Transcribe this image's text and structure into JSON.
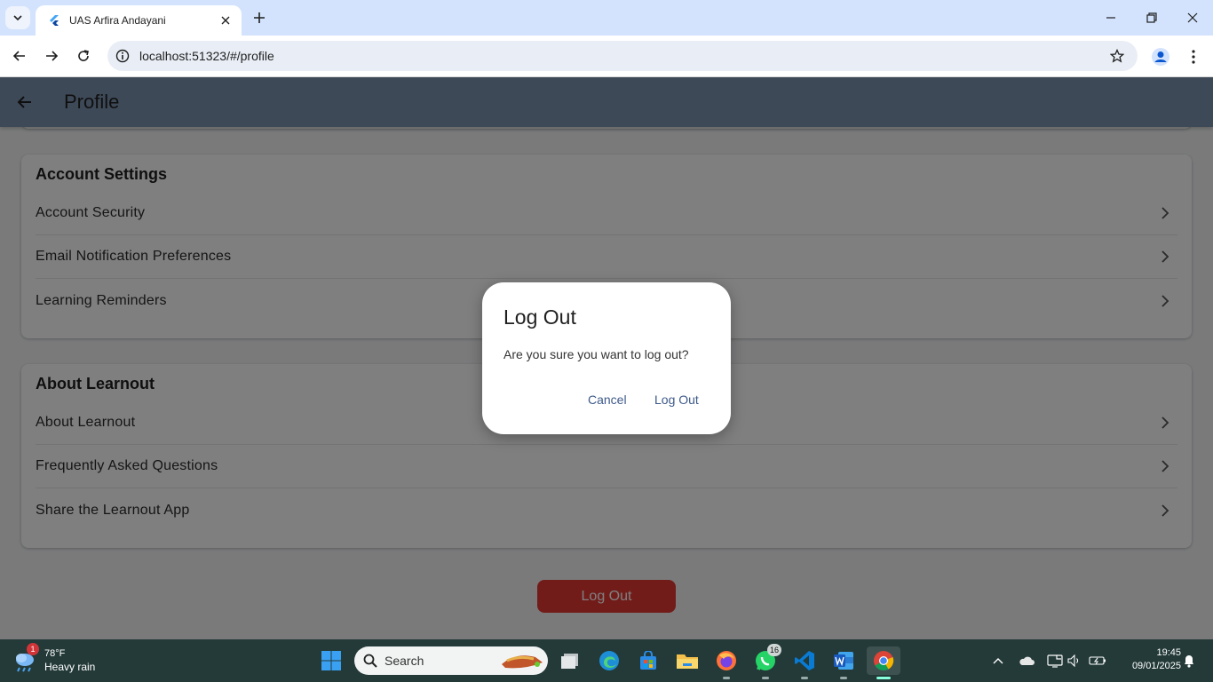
{
  "browser": {
    "tab_title": "UAS Arfira Andayani",
    "url": "localhost:51323/#/profile"
  },
  "app": {
    "title": "Profile",
    "sections": [
      {
        "title": "Account Settings",
        "items": [
          "Account Security",
          "Email Notification Preferences",
          "Learning Reminders"
        ]
      },
      {
        "title": "About Learnout",
        "items": [
          "About Learnout",
          "Frequently Asked Questions",
          "Share the Learnout App"
        ]
      }
    ],
    "logout_label": "Log Out"
  },
  "dialog": {
    "title": "Log Out",
    "message": "Are you sure you want to log out?",
    "cancel_label": "Cancel",
    "confirm_label": "Log Out"
  },
  "taskbar": {
    "weather_temp": "78°F",
    "weather_desc": "Heavy rain",
    "weather_badge": "1",
    "search_placeholder": "Search",
    "whatsapp_badge": "16",
    "time": "19:45",
    "date": "09/01/2025"
  },
  "colors": {
    "appbar": "#7d93b0",
    "logout_button": "#e53935",
    "dialog_button_text": "#3e5a8a",
    "taskbar": "#233a38"
  }
}
